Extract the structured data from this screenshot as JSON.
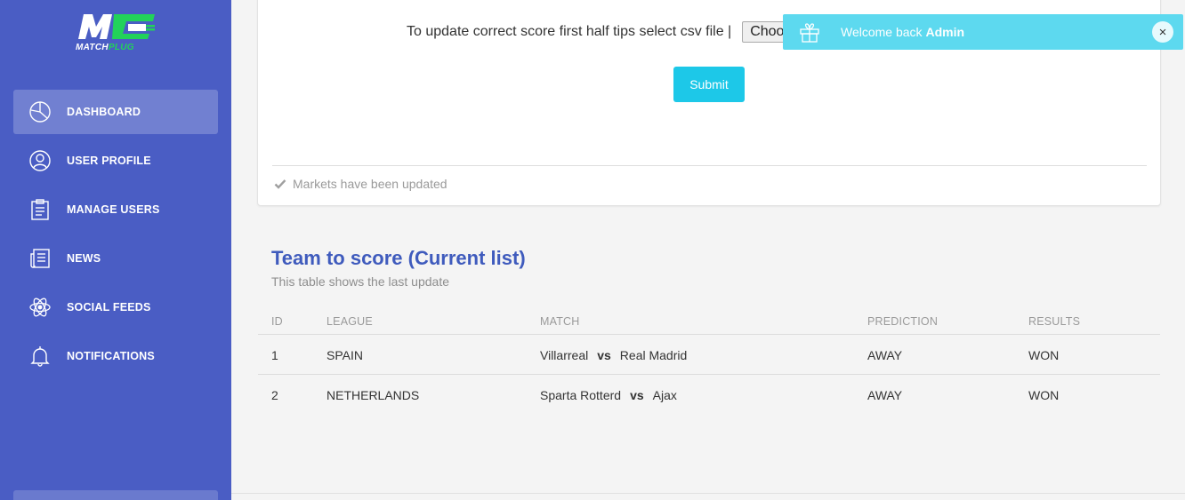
{
  "brand": {
    "name": "MATCH",
    "name_accent": "PLUG",
    "logo_icon": "mp-logo"
  },
  "sidebar": {
    "items": [
      {
        "label": "DASHBOARD",
        "icon": "pie-chart-icon",
        "active": true
      },
      {
        "label": "USER PROFILE",
        "icon": "user-icon",
        "active": false
      },
      {
        "label": "MANAGE USERS",
        "icon": "clipboard-icon",
        "active": false
      },
      {
        "label": "NEWS",
        "icon": "newspaper-icon",
        "active": false
      },
      {
        "label": "SOCIAL FEEDS",
        "icon": "atom-icon",
        "active": false
      },
      {
        "label": "NOTIFICATIONS",
        "icon": "bell-icon",
        "active": false
      }
    ]
  },
  "upload": {
    "label": "To update correct score first half tips select csv file |",
    "file_button": "Choo",
    "submit": "Submit",
    "status": "Markets have been updated"
  },
  "table": {
    "title": "Team to score (Current list)",
    "subtitle": "This table shows the last update",
    "columns": {
      "id": "ID",
      "league": "LEAGUE",
      "match": "MATCH",
      "prediction": "PREDICTION",
      "results": "RESULTS"
    },
    "rows": [
      {
        "id": "1",
        "league": "SPAIN",
        "home": "Villarreal",
        "vs": "vs",
        "away": "Real Madrid",
        "prediction": "AWAY",
        "result": "WON"
      },
      {
        "id": "2",
        "league": "NETHERLANDS",
        "home": "Sparta Rotterd",
        "vs": "vs",
        "away": "Ajax",
        "prediction": "AWAY",
        "result": "WON"
      }
    ]
  },
  "toast": {
    "text": "Welcome back",
    "user": "Admin",
    "close": "×",
    "icon": "gift-icon"
  },
  "colors": {
    "sidebar": "#4a5dc4",
    "accent": "#1dc8e8",
    "toast": "#5dd9ef",
    "title": "#3f5bbd",
    "logo_green": "#22d25a"
  }
}
